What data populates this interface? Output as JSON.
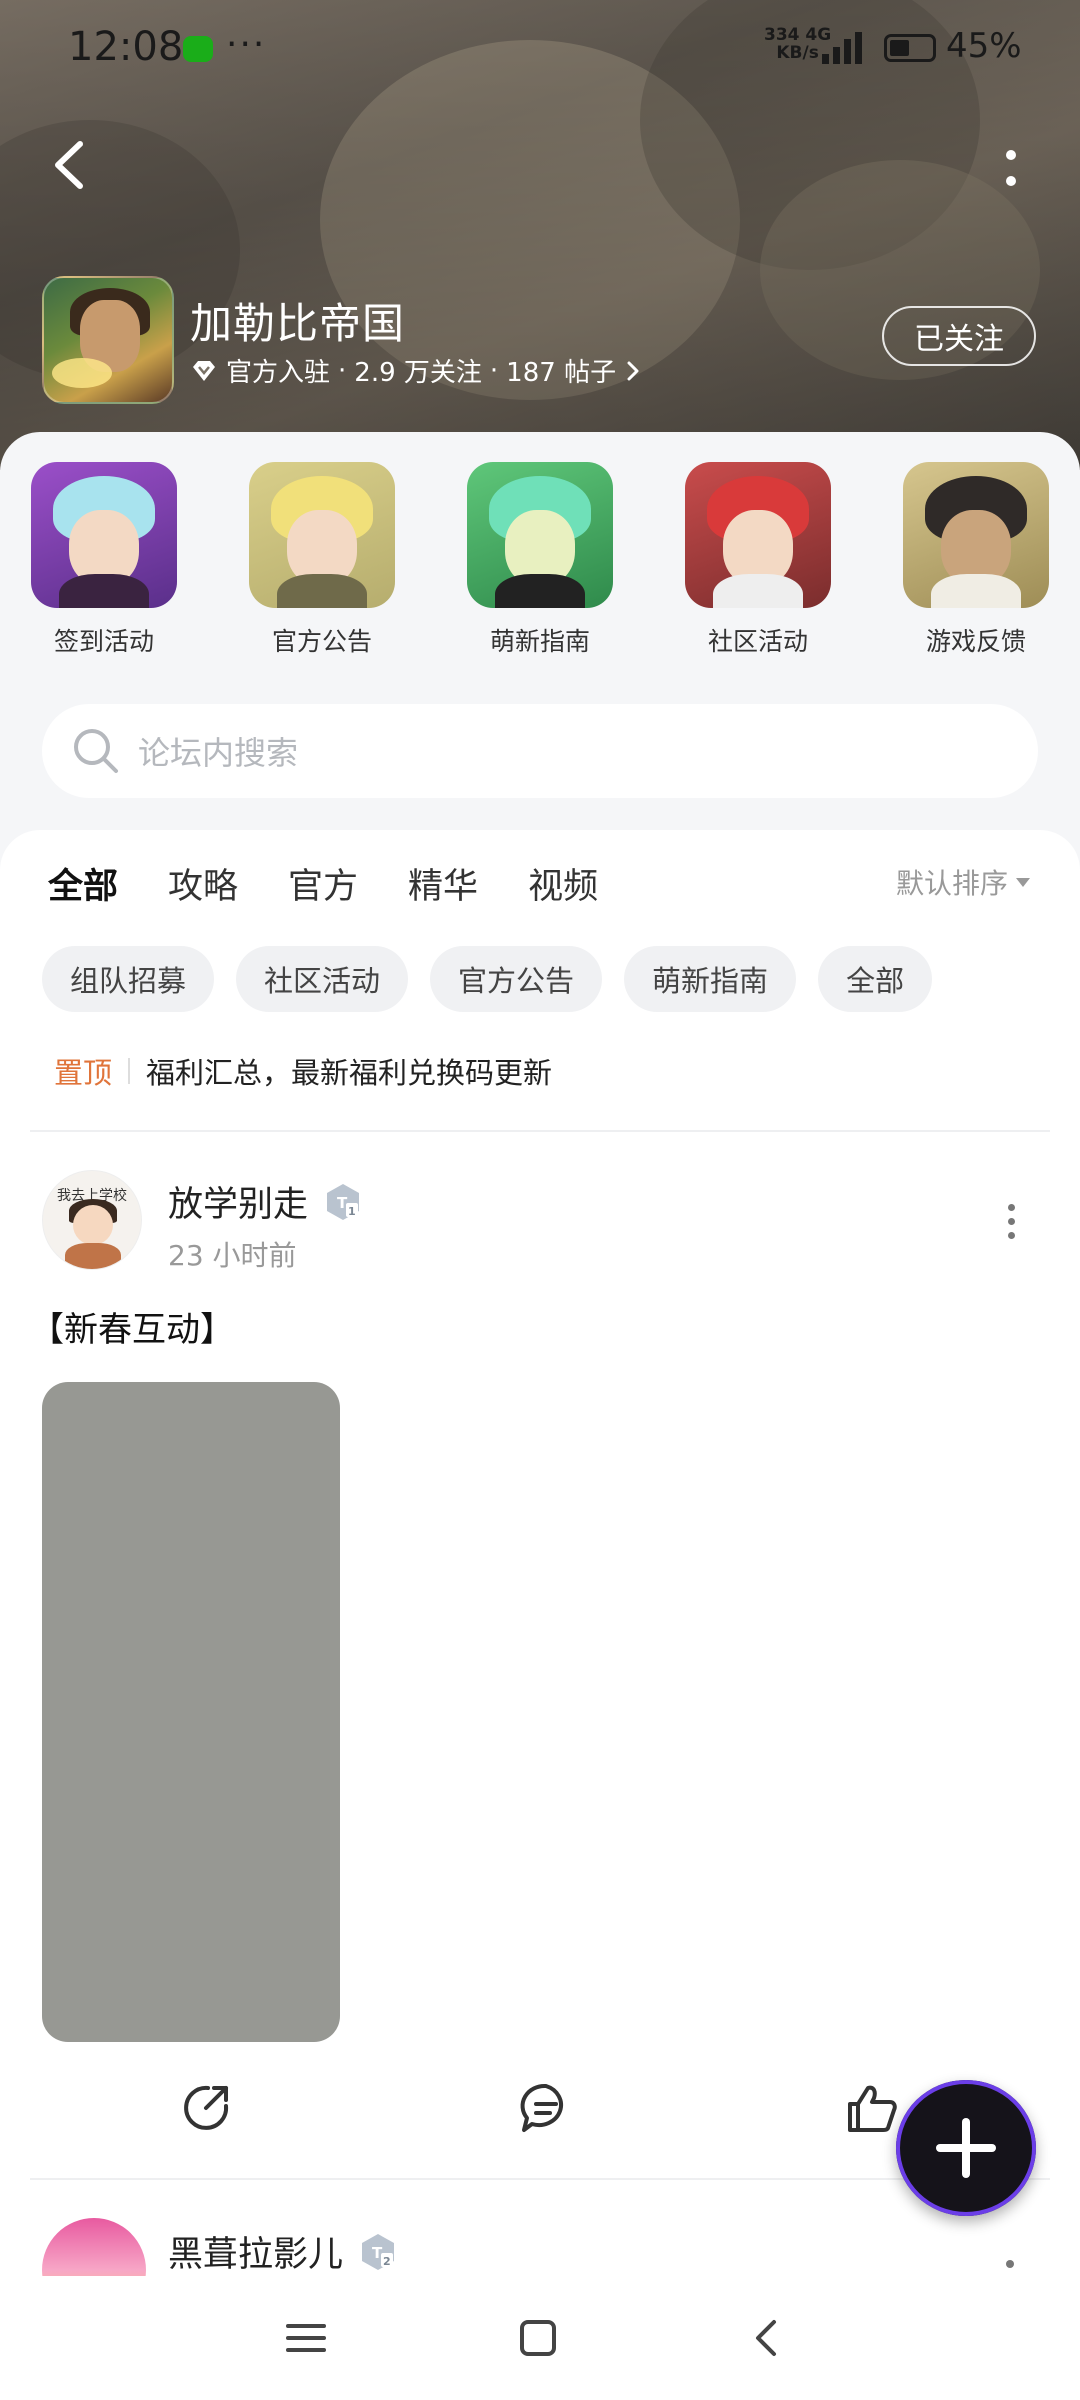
{
  "status_bar": {
    "time": "12:08",
    "dots": "···",
    "net_speed": "334",
    "net_unit": "KB/s",
    "net_type": "4G",
    "battery": "45%"
  },
  "forum": {
    "title": "加勒比帝国",
    "badge": "官方入驻",
    "followers": "2.9 万关注",
    "posts": "187 帖子",
    "separator": "·",
    "follow_label": "已关注"
  },
  "channels": [
    {
      "label": "签到活动"
    },
    {
      "label": "官方公告"
    },
    {
      "label": "萌新指南"
    },
    {
      "label": "社区活动"
    },
    {
      "label": "游戏反馈"
    }
  ],
  "search": {
    "placeholder": "论坛内搜索"
  },
  "tabs": [
    {
      "label": "全部",
      "active": true
    },
    {
      "label": "攻略",
      "active": false
    },
    {
      "label": "官方",
      "active": false
    },
    {
      "label": "精华",
      "active": false
    },
    {
      "label": "视频",
      "active": false
    }
  ],
  "sort": {
    "label": "默认排序"
  },
  "chips": [
    "组队招募",
    "社区活动",
    "官方公告",
    "萌新指南",
    "全部"
  ],
  "pinned": {
    "tag": "置顶",
    "text": "福利汇总，最新福利兑换码更新"
  },
  "posts": [
    {
      "author": "放学别走",
      "level_icon": "level-badge-1",
      "avatar_caption": "我去上学校",
      "time": "23 小时前",
      "title": "【新春互动】"
    },
    {
      "author": "黑葺拉影儿",
      "level_icon": "level-badge-2"
    }
  ],
  "colors": {
    "accent": "#3ed9c4",
    "pinned": "#e0743a",
    "fab_ring": "#6b3ee8"
  }
}
